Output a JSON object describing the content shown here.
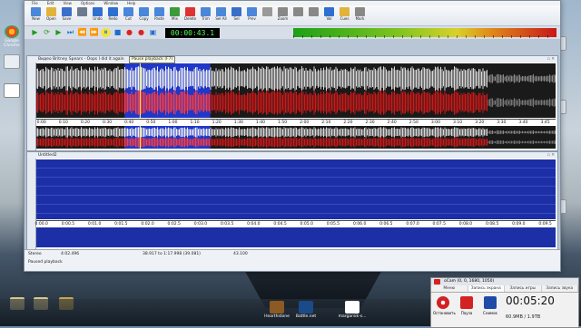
{
  "desktop": {
    "icons": [
      {
        "label": "Google Chrome"
      },
      {
        "label": ""
      },
      {
        "label": ""
      }
    ],
    "bottom_icons": [
      {
        "label": ""
      },
      {
        "label": ""
      },
      {
        "label": ""
      }
    ],
    "taskbar_items": [
      {
        "label": "Hearthstone"
      },
      {
        "label": "Battle.net"
      },
      {
        "label": "margarsik-s..."
      }
    ]
  },
  "app": {
    "menu": [
      "File",
      "Edit",
      "View",
      "Options",
      "Window",
      "Help"
    ],
    "toolbar": [
      {
        "label": "New"
      },
      {
        "label": "Open"
      },
      {
        "label": "Save"
      },
      {
        "label": ""
      },
      {
        "label": "Undo"
      },
      {
        "label": "Redo"
      },
      {
        "label": "Cut"
      },
      {
        "label": "Copy"
      },
      {
        "label": "Paste"
      },
      {
        "label": "Mix"
      },
      {
        "label": "Delete"
      },
      {
        "label": "Trim"
      },
      {
        "label": "Sel All"
      },
      {
        "label": "Sel"
      },
      {
        "label": "Prev"
      },
      {
        "label": ""
      },
      {
        "label": "Zoom"
      },
      {
        "label": ""
      },
      {
        "label": ""
      },
      {
        "label": "Vol"
      },
      {
        "label": "Cues"
      },
      {
        "label": "Mark"
      }
    ],
    "transport": {
      "time": "00:00:43.1"
    },
    "meter_colors": [
      "#1da016",
      "#d8d12a",
      "#c71818"
    ],
    "track1": {
      "title": "Видео Britney Spears - Oops I did it again",
      "tooltip": "Pause playback (F7)",
      "ruler": [
        "0:00",
        "0:10",
        "0:20",
        "0:30",
        "0:40",
        "0:50",
        "1:00",
        "1:10",
        "1:20",
        "1:30",
        "1:40",
        "1:50",
        "2:00",
        "2:10",
        "2:20",
        "2:30",
        "2:40",
        "2:50",
        "3:00",
        "3:10",
        "3:20",
        "3:30",
        "3:40",
        "3:45"
      ],
      "playback_position": 0.2,
      "selection": [
        0.17,
        0.335
      ]
    },
    "track2": {
      "title": "Untitled2",
      "ruler": [
        "0:00.0",
        "0:00.5",
        "0:01.0",
        "0:01.5",
        "0:02.0",
        "0:02.5",
        "0:03.0",
        "0:03.5",
        "0:04.0",
        "0:04.5",
        "0:05.0",
        "0:05.5",
        "0:06.0",
        "0:06.5",
        "0:07.0",
        "0:07.5",
        "0:08.0",
        "0:08.5",
        "0:09.0",
        "0:09.5"
      ]
    },
    "status": {
      "mode": "Stereo",
      "length": "4:02.496",
      "selection": "38.917 to 1:17.998 (39.081)",
      "zoom": "43.100",
      "message": "Paused playback"
    }
  },
  "recorder": {
    "title": "oCam (0, 0, 1680, 1050)",
    "tabs": [
      "Меню",
      "Запись экрана",
      "Запись игры",
      "Запись звука"
    ],
    "buttons": [
      {
        "label": "Остановить"
      },
      {
        "label": "Пауза"
      },
      {
        "label": "Снимок"
      }
    ],
    "time": "00:05:20",
    "size": "60.9MB / 1.9TB"
  }
}
